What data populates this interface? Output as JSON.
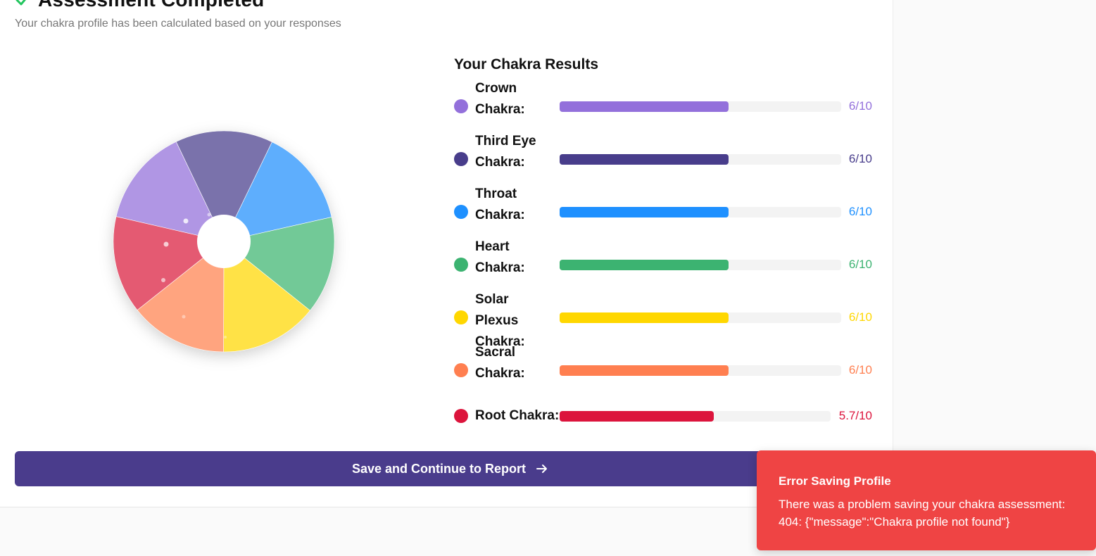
{
  "header": {
    "title": "Assessment Completed",
    "subtitle": "Your chakra profile has been calculated based on your responses"
  },
  "results": {
    "title": "Your Chakra Results",
    "items": [
      {
        "label": "Crown Chakra:",
        "score_text": "6/10",
        "value": 6,
        "max": 10,
        "color": "#9370DB"
      },
      {
        "label": "Third Eye Chakra:",
        "score_text": "6/10",
        "value": 6,
        "max": 10,
        "color": "#483D8B"
      },
      {
        "label": "Throat Chakra:",
        "score_text": "6/10",
        "value": 6,
        "max": 10,
        "color": "#1E90FF"
      },
      {
        "label": "Heart Chakra:",
        "score_text": "6/10",
        "value": 6,
        "max": 10,
        "color": "#3CB371"
      },
      {
        "label": "Solar Plexus Chakra:",
        "score_text": "6/10",
        "value": 6,
        "max": 10,
        "color": "#FFD700"
      },
      {
        "label": "Sacral Chakra:",
        "score_text": "6/10",
        "value": 6,
        "max": 10,
        "color": "#FF7F50"
      },
      {
        "label": "Root Chakra:",
        "score_text": "5.7/10",
        "value": 5.7,
        "max": 10,
        "color": "#DC143C"
      }
    ]
  },
  "wheel": {
    "segments": [
      {
        "name": "Crown",
        "color": "#b096e4"
      },
      {
        "name": "Third Eye",
        "color": "#7a72ab"
      },
      {
        "name": "Throat",
        "color": "#5eaefd"
      },
      {
        "name": "Heart",
        "color": "#72c997"
      },
      {
        "name": "Solar Plexus",
        "color": "#ffe246"
      },
      {
        "name": "Sacral",
        "color": "#ffa47f"
      },
      {
        "name": "Root",
        "color": "#e45a72"
      }
    ]
  },
  "actions": {
    "save_label": "Save and Continue to Report"
  },
  "toast": {
    "title": "Error Saving Profile",
    "message": "There was a problem saving your chakra assessment: 404: {\"message\":\"Chakra profile not found\"}"
  },
  "colors": {
    "primary_button": "#4a3c8c",
    "success_check": "#22c55e",
    "error_toast": "#ef4444"
  }
}
